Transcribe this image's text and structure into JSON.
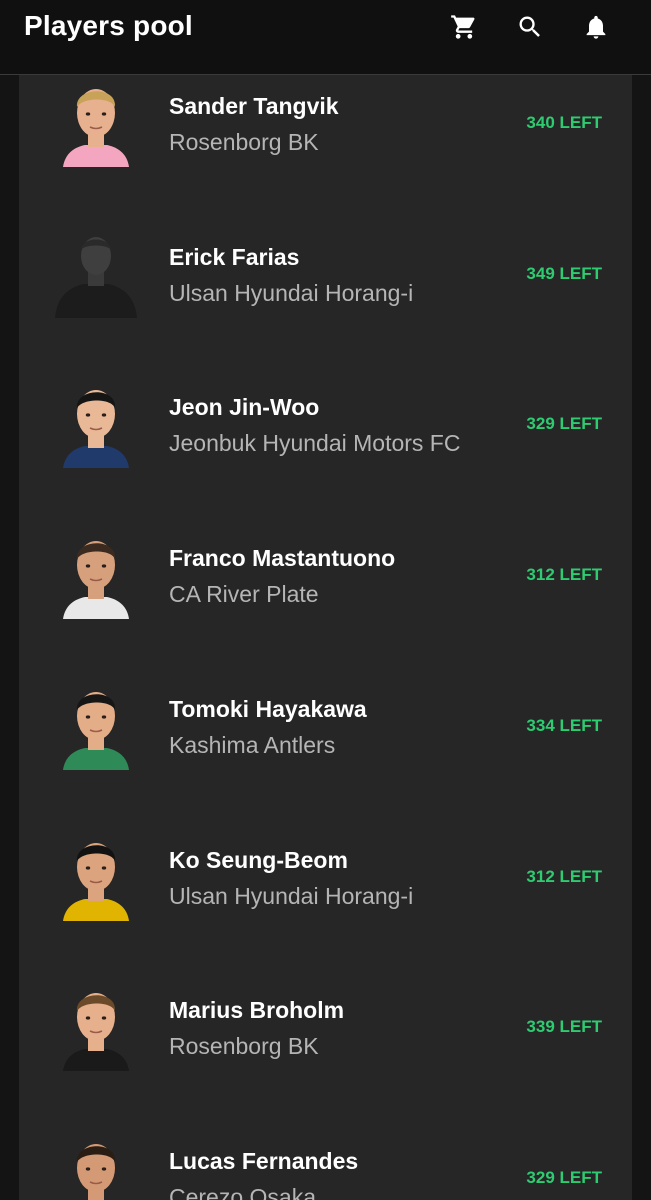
{
  "header": {
    "title": "Players pool",
    "icons": [
      "cart-icon",
      "search-icon",
      "bell-icon"
    ]
  },
  "colors": {
    "accent": "#2ecc71",
    "background": "#141414",
    "card": "#262626",
    "name": "#ffffff",
    "team": "#b5b5b5"
  },
  "players": [
    {
      "name": "Sander Tangvik",
      "team": "Rosenborg BK",
      "left": "340 LEFT",
      "avatar": "player-photo"
    },
    {
      "name": "Erick Farias",
      "team": "Ulsan Hyundai Horang-i",
      "left": "349 LEFT",
      "avatar": "silhouette"
    },
    {
      "name": "Jeon Jin-Woo",
      "team": "Jeonbuk Hyundai Motors FC",
      "left": "329 LEFT",
      "avatar": "player-photo"
    },
    {
      "name": "Franco Mastantuono",
      "team": "CA River Plate",
      "left": "312 LEFT",
      "avatar": "player-photo"
    },
    {
      "name": "Tomoki Hayakawa",
      "team": "Kashima Antlers",
      "left": "334 LEFT",
      "avatar": "player-photo"
    },
    {
      "name": "Ko Seung-Beom",
      "team": "Ulsan Hyundai Horang-i",
      "left": "312 LEFT",
      "avatar": "player-photo"
    },
    {
      "name": "Marius Broholm",
      "team": "Rosenborg BK",
      "left": "339 LEFT",
      "avatar": "player-photo"
    },
    {
      "name": "Lucas Fernandes",
      "team": "Cerezo Osaka",
      "left": "329 LEFT",
      "avatar": "player-photo"
    }
  ]
}
